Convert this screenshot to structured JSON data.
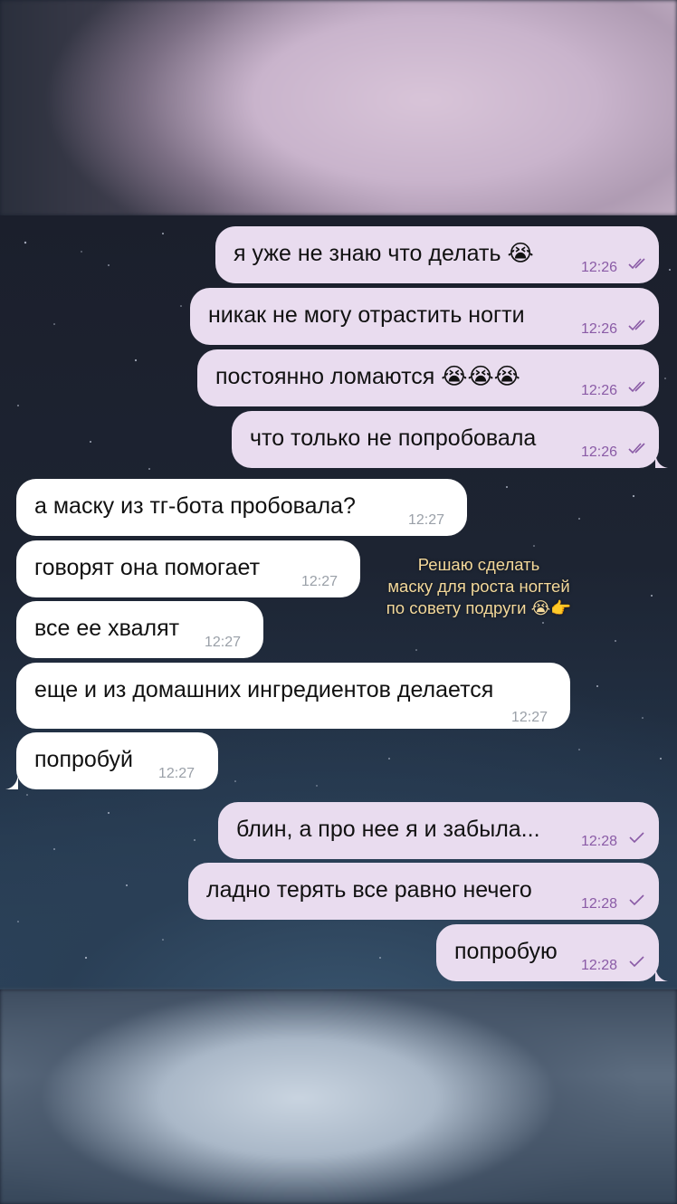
{
  "outgoing_top": [
    {
      "text": "я уже не знаю что делать",
      "emoji": "😭",
      "time": "12:26"
    },
    {
      "text": "никак не могу отрастить ногти",
      "emoji": "",
      "time": "12:26"
    },
    {
      "text": "постоянно ломаются",
      "emoji": "😭😭😭",
      "time": "12:26"
    },
    {
      "text": "что только не попробовала",
      "emoji": "",
      "time": "12:26"
    }
  ],
  "incoming": [
    {
      "text": "а маску из тг-бота пробовала?",
      "time": "12:27"
    },
    {
      "text": "говорят она помогает",
      "time": "12:27"
    },
    {
      "text": "все ее хвалят",
      "time": "12:27"
    },
    {
      "text": "еще и из домашних ингредиентов делается",
      "time": "12:27"
    },
    {
      "text": "попробуй",
      "time": "12:27"
    }
  ],
  "outgoing_bottom": [
    {
      "text": "блин, а про нее я и забыла...",
      "time": "12:28"
    },
    {
      "text": "ладно терять все равно нечего",
      "time": "12:28"
    },
    {
      "text": "попробую",
      "time": "12:28"
    }
  ],
  "caption": {
    "line1": "Решаю сделать",
    "line2": "маску для роста ногтей",
    "line3": "по совету подруги",
    "emoji": "😭👉"
  },
  "colors": {
    "outgoing_bubble": "#e9dcef",
    "incoming_bubble": "#ffffff",
    "outgoing_time": "#8a5ba6",
    "caption_text": "#f3d89a"
  }
}
